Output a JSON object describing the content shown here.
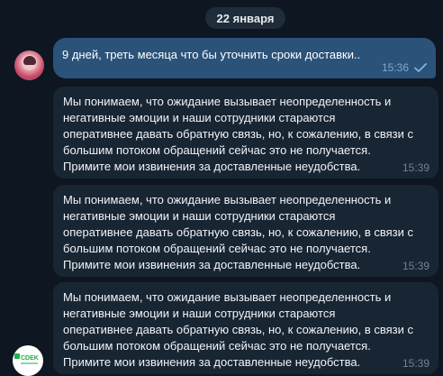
{
  "date_separator": "22 января",
  "outgoing": {
    "text": "9 дней, треть месяца что бы уточнить сроки доставки..",
    "time": "15:36"
  },
  "incoming": [
    {
      "lines": [
        "Мы понимаем, что ожидание вызывает неопределенность и",
        "негативные эмоции и наши сотрудники стараются",
        "оперативнее давать обратную связь, но, к сожалению, в связи с",
        "большим потоком обращений сейчас это не получается.",
        "Примите мои извинения за доставленные неудобства."
      ],
      "time": "15:39"
    },
    {
      "lines": [
        "Мы понимаем, что ожидание вызывает неопределенность и",
        "негативные эмоции и наши сотрудники стараются",
        "оперативнее давать обратную связь, но, к сожалению, в связи с",
        "большим потоком обращений сейчас это не получается.",
        "Примите мои извинения за доставленные неудобства."
      ],
      "time": "15:39"
    },
    {
      "lines": [
        "Мы понимаем, что ожидание вызывает неопределенность и",
        "негативные эмоции и наши сотрудники стараются",
        "оперативнее давать обратную связь, но, к сожалению, в связи с",
        "большим потоком обращений сейчас это не получается.",
        "Примите мои извинения за доставленные неудобства."
      ],
      "time": "15:39"
    }
  ],
  "bot_avatar_logo": "CDEK",
  "colors": {
    "background": "#0e1621",
    "outgoing_bubble": "#2b5278",
    "incoming_bubble": "#182533",
    "date_pill": "#1f2c3a",
    "cdek_green": "#1ab248"
  }
}
